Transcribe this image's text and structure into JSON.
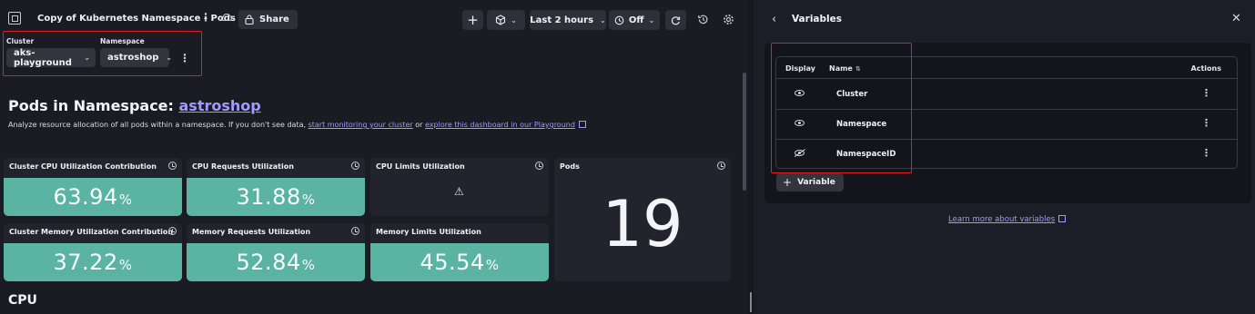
{
  "header": {
    "title": "Copy of Kubernetes Namespace - Pods",
    "share_label": "Share",
    "timeframe": "Last 2 hours",
    "refresh": "Off"
  },
  "variables": {
    "cluster": {
      "label": "Cluster",
      "value": "aks-playground"
    },
    "namespace": {
      "label": "Namespace",
      "value": "astroshop"
    }
  },
  "section": {
    "title_prefix": "Pods in Namespace: ",
    "title_link": "astroshop",
    "desc_prefix": "Analyze resource allocation of all pods within a namespace. If you don't see data, ",
    "link_monitoring": "start monitoring your cluster",
    "desc_or": " or ",
    "link_playground": "explore this dashboard in our Playground"
  },
  "tiles": [
    {
      "title": "Cluster CPU Utilization Contribution",
      "value": "63.94",
      "unit": "%"
    },
    {
      "title": "CPU Requests Utilization",
      "value": "31.88",
      "unit": "%"
    },
    {
      "title": "CPU Limits Utilization",
      "warning": "⚠"
    },
    {
      "title": "Pods",
      "value": "19"
    },
    {
      "title": "Cluster Memory Utilization Contribution",
      "value": "37.22",
      "unit": "%"
    },
    {
      "title": "Memory Requests Utilization",
      "value": "52.84",
      "unit": "%"
    },
    {
      "title": "Memory Limits Utilization",
      "value": "45.54",
      "unit": "%"
    }
  ],
  "cpu_heading": "CPU",
  "panel": {
    "title": "Variables",
    "columns": {
      "display": "Display",
      "name": "Name",
      "actions": "Actions"
    },
    "rows": [
      {
        "name": "Cluster",
        "visible": true
      },
      {
        "name": "Namespace",
        "visible": true
      },
      {
        "name": "NamespaceID",
        "visible": false
      }
    ],
    "add_label": "Variable",
    "learn_more": "Learn more about variables"
  },
  "colors": {
    "accent_link": "#9f9cff",
    "tile_good": "#5ab3a3",
    "highlight": "#e02020",
    "background": "#1b1b24"
  },
  "icons": [
    "dashboard-icon",
    "more-vertical-icon",
    "cloud-sync-icon",
    "lock-icon",
    "plus-icon",
    "cube-icon",
    "refresh-clock-icon",
    "reload-icon",
    "history-icon",
    "gear-icon",
    "clock-icon",
    "warning-icon",
    "eye-icon",
    "eye-off-icon",
    "chevron-left-icon",
    "close-icon",
    "external-link-icon"
  ]
}
